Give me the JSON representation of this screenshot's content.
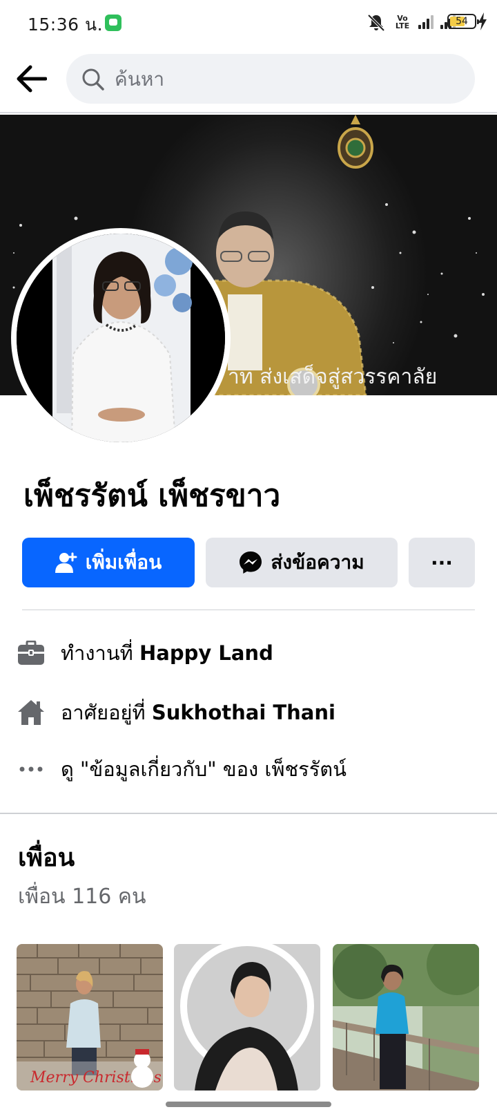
{
  "status_bar": {
    "time": "15:36 น.",
    "network_label": "Vo LTE",
    "battery": "54"
  },
  "search": {
    "placeholder": "ค้นหา"
  },
  "cover": {
    "caption": "าท ส่งเสด็จสู่สวรรคาลัย"
  },
  "profile": {
    "name": "เพ็ชรรัตน์ เพ็ชรขาว"
  },
  "actions": {
    "add_friend": "เพิ่มเพื่อน",
    "message": "ส่งข้อความ",
    "more": "···"
  },
  "info": {
    "work_prefix": "ทำงานที่ ",
    "work_value": "Happy Land",
    "live_prefix": "อาศัยอยู่ที่ ",
    "live_value": "Sukhothai Thani",
    "about": "ดู \"ข้อมูลเกี่ยวกับ\" ของ เพ็ชรรัตน์"
  },
  "friends": {
    "title": "เพื่อน",
    "count": "เพื่อน 116 คน",
    "tile_1_text": "Merry Christmas"
  },
  "colors": {
    "primary": "#0866ff",
    "secondary_button": "#e4e6eb",
    "muted_text": "#65676b"
  }
}
